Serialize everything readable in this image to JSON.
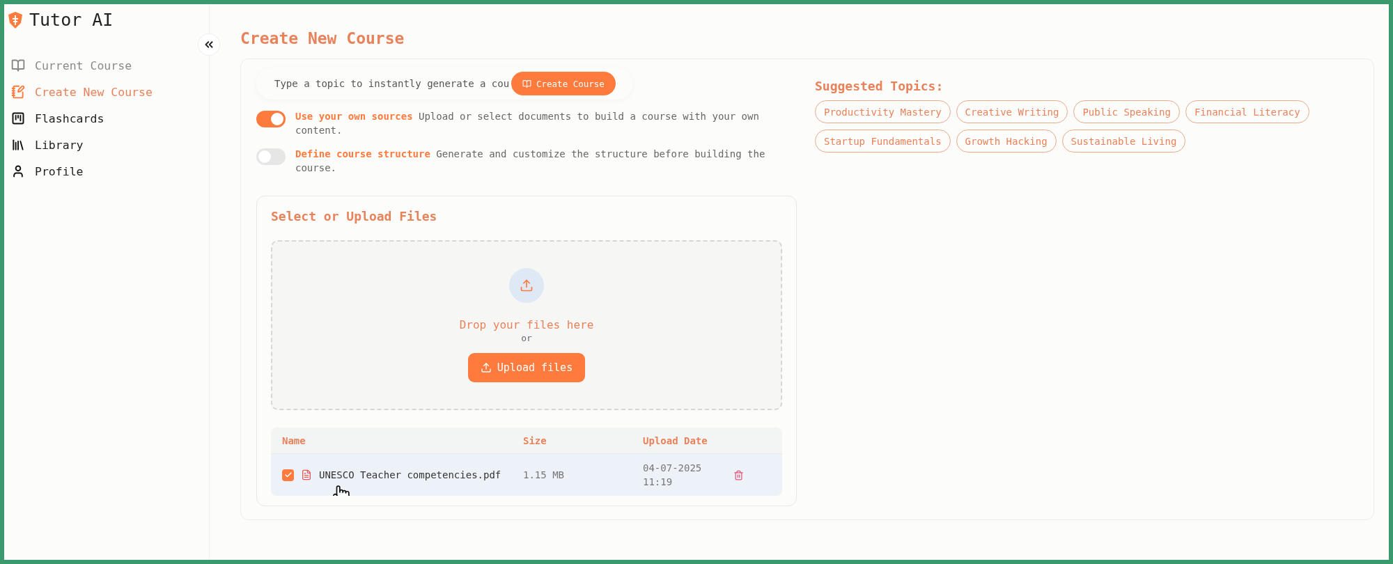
{
  "app": {
    "name": "Tutor AI"
  },
  "sidebar": {
    "items": [
      {
        "label": "Current Course",
        "selected": false,
        "disabled": true
      },
      {
        "label": "Create New Course",
        "selected": true,
        "disabled": false
      },
      {
        "label": "Flashcards",
        "selected": false,
        "disabled": false
      },
      {
        "label": "Library",
        "selected": false,
        "disabled": false
      },
      {
        "label": "Profile",
        "selected": false,
        "disabled": false
      }
    ]
  },
  "page": {
    "title": "Create New Course"
  },
  "topic_input": {
    "placeholder": "Type a topic to instantly generate a cou",
    "button": "Create Course"
  },
  "options": [
    {
      "label": "Use your own sources",
      "description": "Upload or select documents to build a course with your own content.",
      "on": true
    },
    {
      "label": "Define course structure",
      "description": "Generate and customize the structure before building the course.",
      "on": false
    }
  ],
  "upload": {
    "title": "Select or Upload Files",
    "drop_text": "Drop your files here",
    "or_text": "or",
    "button": "Upload files",
    "table": {
      "columns": [
        "Name",
        "Size",
        "Upload Date"
      ],
      "rows": [
        {
          "checked": true,
          "name": "UNESCO Teacher competencies.pdf",
          "size": "1.15 MB",
          "upload_date": "04-07-2025 11:19"
        }
      ]
    }
  },
  "suggested": {
    "title": "Suggested Topics:",
    "topics": [
      "Productivity Mastery",
      "Creative Writing",
      "Public Speaking",
      "Financial Literacy",
      "Startup Fundamentals",
      "Growth Hacking",
      "Sustainable Living"
    ]
  }
}
